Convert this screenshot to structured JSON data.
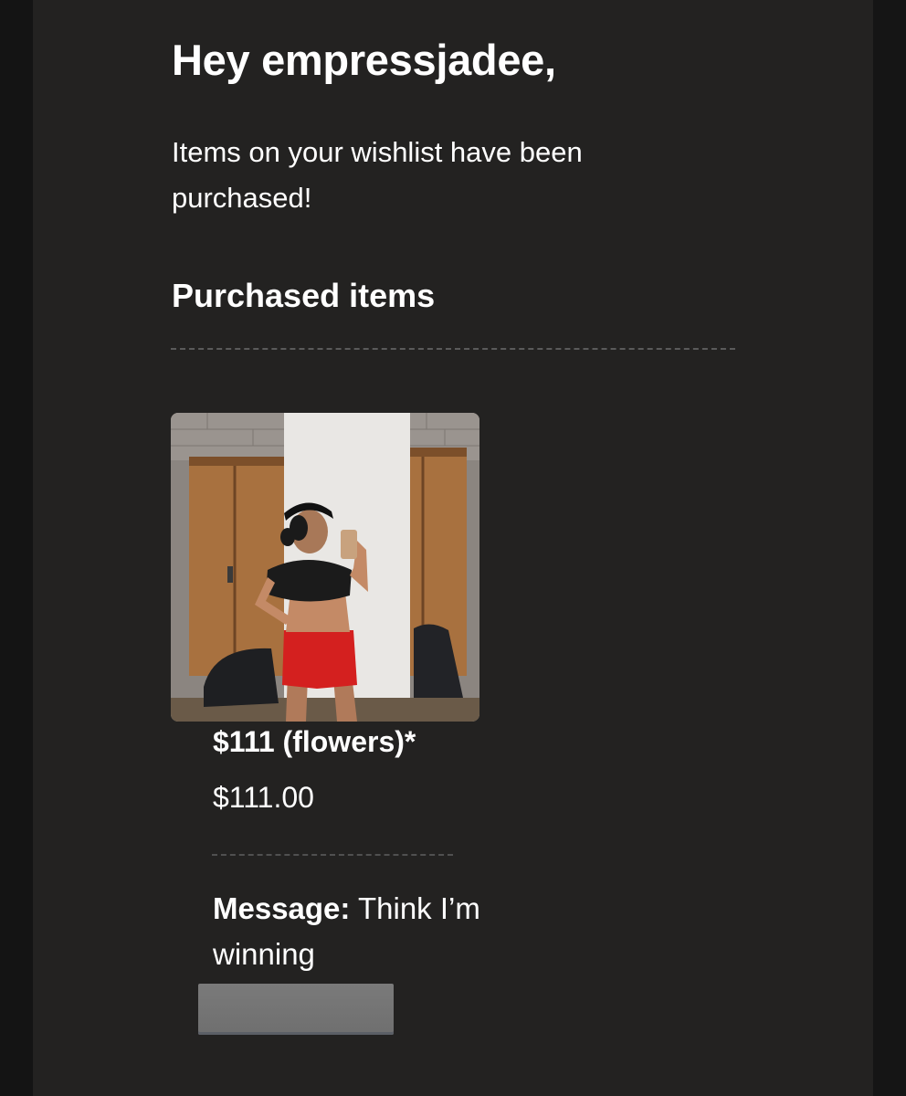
{
  "email": {
    "greeting": "Hey empressjadee,",
    "intro": "Items on your wishlist have been purchased!",
    "section_title": "Purchased items"
  },
  "purchased_items": [
    {
      "name": "$111 (flowers)*",
      "price": "$111.00",
      "message_label": "Message:",
      "message_text": "Think I’m winning"
    }
  ],
  "colors": {
    "page_background": "#121212",
    "email_background": "#232221",
    "text": "#ffffff",
    "divider": "#5a5a5a",
    "redaction_box": "#757575"
  }
}
